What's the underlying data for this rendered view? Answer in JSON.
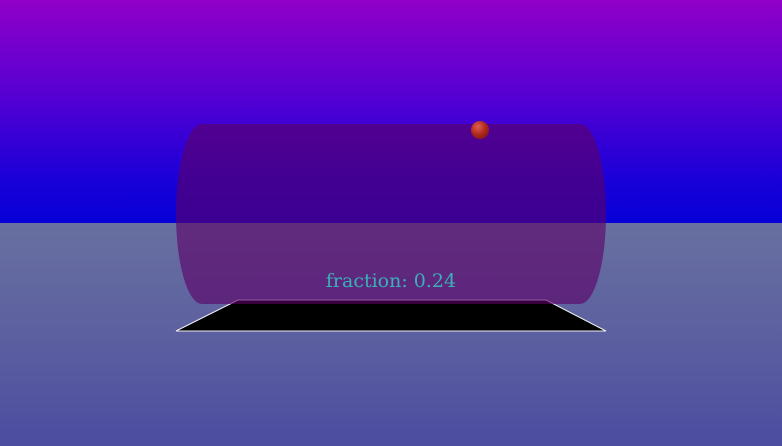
{
  "hud": {
    "fraction_label": "fraction: 0.24",
    "fraction_value": 0.24
  },
  "colors": {
    "sky_top": "#9000c8",
    "sky_bottom": "#0800d8",
    "ground": "#5c60a0",
    "cylinder": "#5c0068",
    "platform": "#000000",
    "ball": "#b02a20",
    "text": "#3ab0b8"
  },
  "objects": {
    "ball_icon": "red-sphere",
    "platform_icon": "black-plane"
  }
}
